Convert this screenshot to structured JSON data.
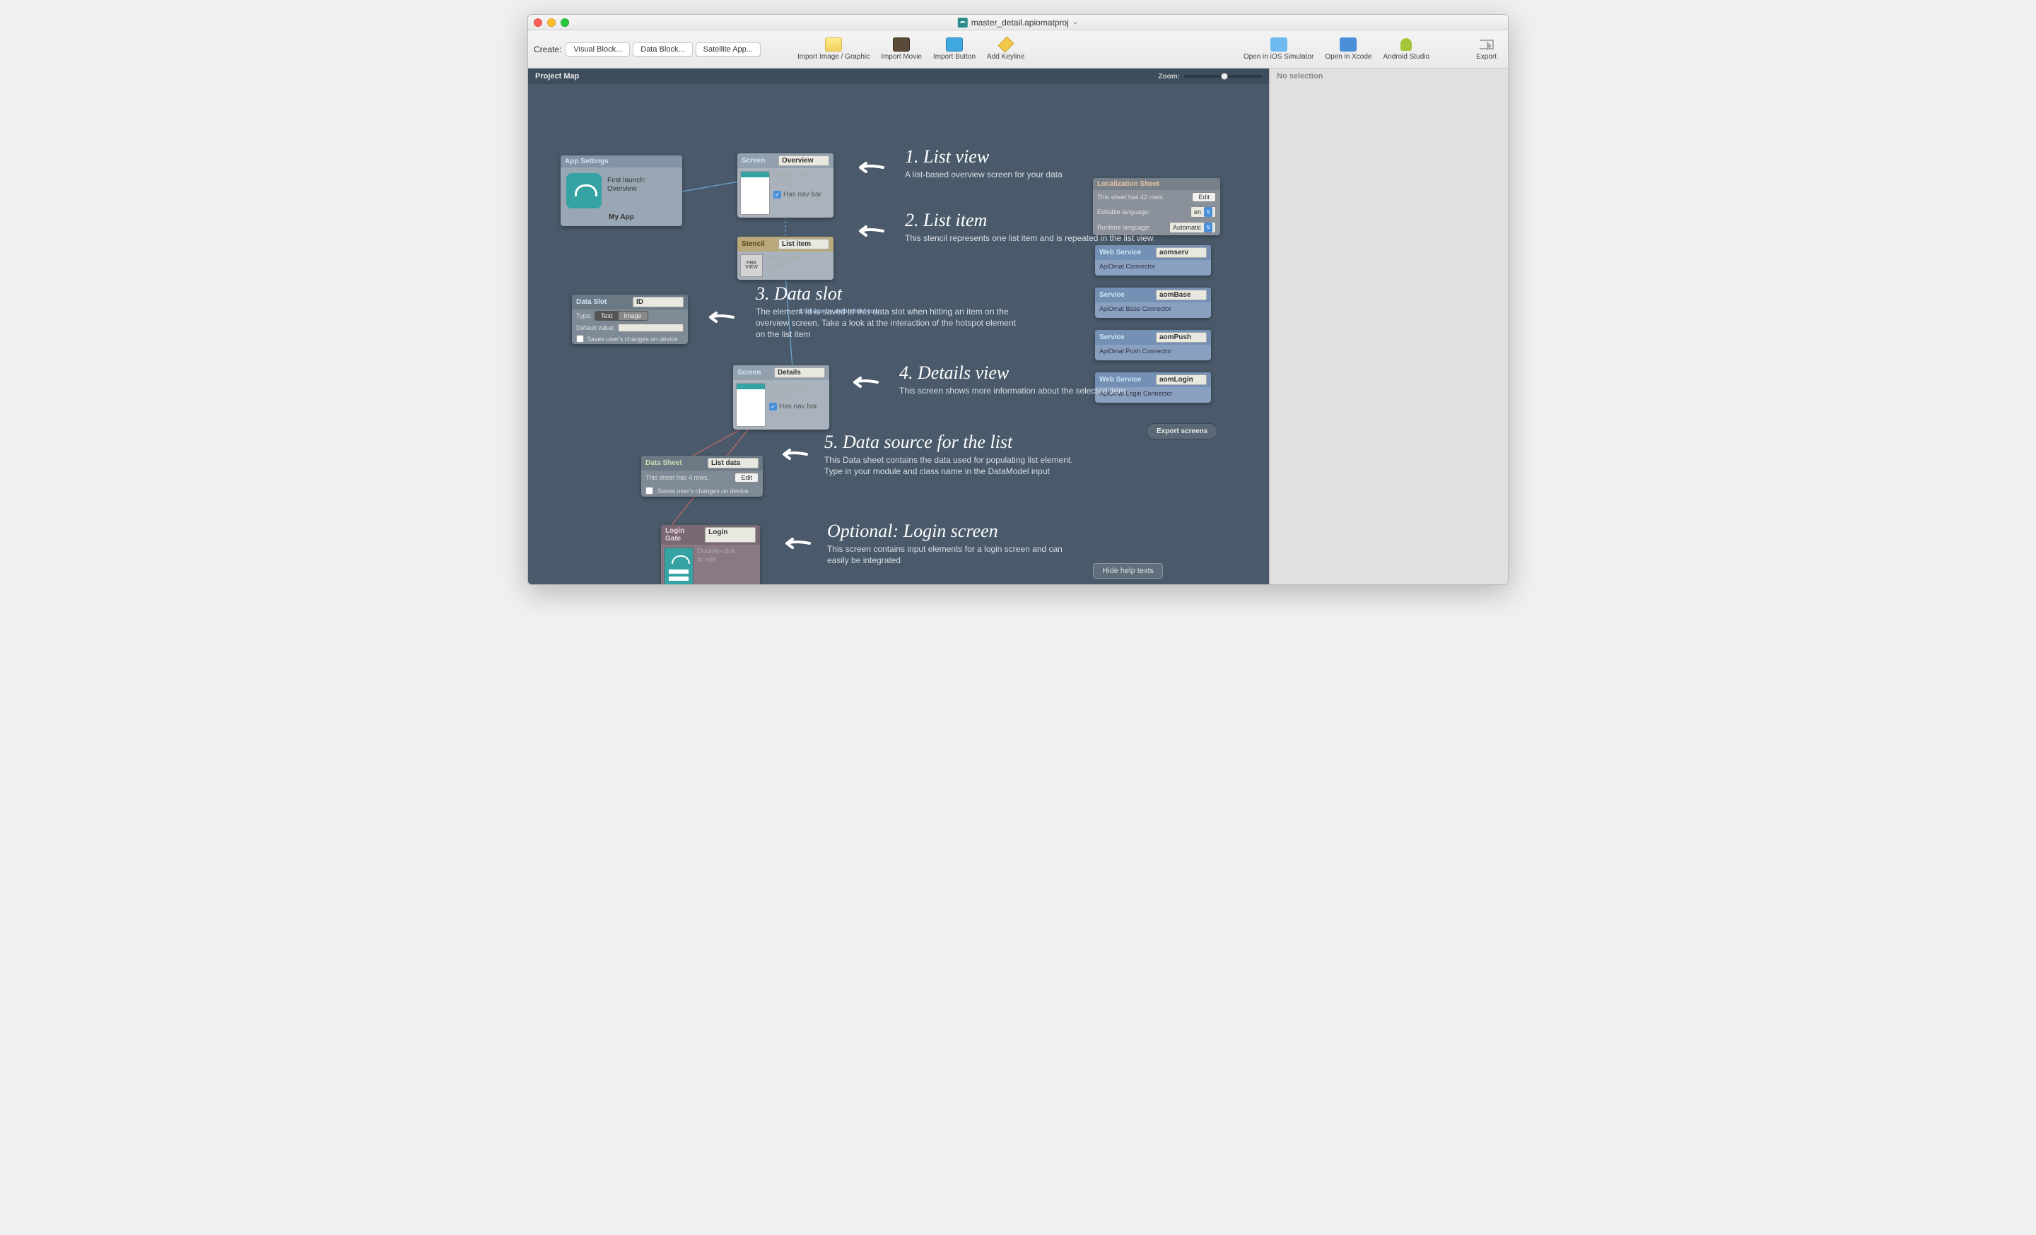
{
  "titlebar": {
    "filename": "master_detail.apiomatproj",
    "traffic": {
      "close": "#ff5f57",
      "min": "#ffbd2e",
      "max": "#28c940"
    }
  },
  "toolbar": {
    "create_label": "Create:",
    "buttons": {
      "visual": "Visual Block...",
      "data": "Data Block...",
      "satellite": "Satellite App..."
    },
    "tools": {
      "import_image": "Import Image / Graphic",
      "import_movie": "Import Movie",
      "import_button": "Import Button",
      "add_keyline": "Add Keyline",
      "ios_sim": "Open in iOS Simulator",
      "xcode": "Open in Xcode",
      "android": "Android Studio",
      "export": "Export"
    }
  },
  "canvas": {
    "title": "Project Map",
    "zoom_label": "Zoom:"
  },
  "inspector": {
    "title": "No selection"
  },
  "nodes": {
    "app": {
      "head": "App Settings",
      "first_launch_label": "First launch:",
      "first_launch_value": "Overview",
      "name": "My App"
    },
    "screen_overview": {
      "head": "Screen",
      "name": "Overview",
      "hint1": "Double-click",
      "hint2": "to edit",
      "nav": "Has nav bar"
    },
    "stencil": {
      "head": "Stencil",
      "name": "List item",
      "hint1": "Double-click",
      "hint2": "to edit",
      "thumb": "PRE\nVIEW"
    },
    "slot": {
      "head": "Data Slot",
      "name": "ID",
      "type_label": "Type:",
      "type_text": "Text",
      "type_image": "Image",
      "default_label": "Default value:",
      "save_label": "Saves user's changes on device"
    },
    "linkage": "Linkage by data sheet row",
    "screen_details": {
      "head": "Screen",
      "name": "Details",
      "hint1": "Double-click",
      "hint2": "to edit",
      "nav": "Has nav bar"
    },
    "sheet": {
      "head": "Data Sheet",
      "name": "List data",
      "rows_text": "This sheet has 4 rows.",
      "edit": "Edit",
      "save_label": "Saves user's changes on device"
    },
    "login": {
      "head": "Login Gate",
      "name": "Login",
      "hint1": "Double-click",
      "hint2": "to edit"
    },
    "loc": {
      "head": "Localization Sheet",
      "rows_text": "This sheet has 42 rows.",
      "edit": "Edit",
      "editable_lang_label": "Editable language:",
      "editable_lang_value": "en",
      "runtime_lang_label": "Runtime language:",
      "runtime_lang_value": "Automatic"
    },
    "svc1": {
      "head": "Web Service",
      "name": "aomserv",
      "desc": "ApiOmat Connector"
    },
    "svc2": {
      "head": "Service",
      "name": "aomBase",
      "desc": "ApiOmat Base Connector"
    },
    "svc3": {
      "head": "Service",
      "name": "aomPush",
      "desc": "ApiOmat Push Connector"
    },
    "svc4": {
      "head": "Web Service",
      "name": "aomLogin",
      "desc": "ApiOmat Login Connector"
    },
    "export_screens": "Export screens"
  },
  "annos": {
    "a1": {
      "title": "1. List view",
      "text": "A list-based overview screen for your data"
    },
    "a2": {
      "title": "2. List item",
      "text": "This stencil represents one list item and is repeated in the list view"
    },
    "a3": {
      "title": "3. Data slot",
      "text": "The element id is saved to this data slot when hitting an item on the overview screen. Take a look at the interaction of the hotspot element on the list item"
    },
    "a4": {
      "title": "4. Details view",
      "text": "This screen shows more information about the selected item"
    },
    "a5": {
      "title": "5. Data source for the list",
      "text": "This Data sheet contains the data used for populating list element. Type in your module and class name in the DataModel input"
    },
    "a6": {
      "title": "Optional: Login screen",
      "text": "This screen contains input elements for a login screen and can easily be integrated"
    }
  },
  "hide_help": "Hide help texts"
}
